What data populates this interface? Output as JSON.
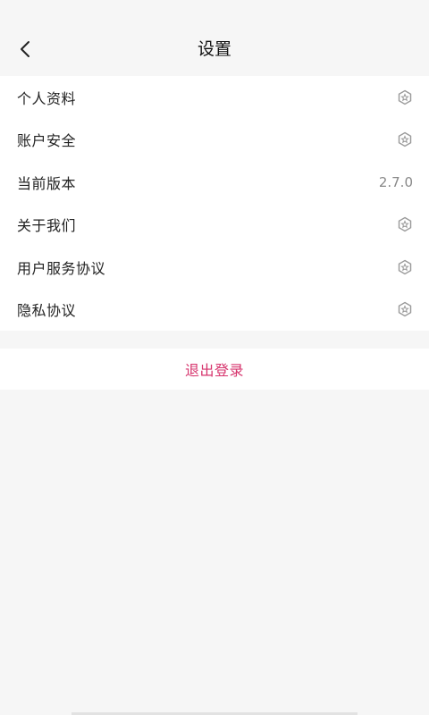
{
  "header": {
    "title": "设置",
    "back_icon": "chevron-left-icon"
  },
  "settings": {
    "items": [
      {
        "label": "个人资料",
        "icon": "hexagon-star-icon"
      },
      {
        "label": "账户安全",
        "icon": "hexagon-star-icon"
      },
      {
        "label": "当前版本",
        "value": "2.7.0"
      },
      {
        "label": "关于我们",
        "icon": "hexagon-star-icon"
      },
      {
        "label": "用户服务协议",
        "icon": "hexagon-star-icon"
      },
      {
        "label": "隐私协议",
        "icon": "hexagon-star-icon"
      }
    ]
  },
  "logout": {
    "label": "退出登录",
    "color": "#d6336c"
  },
  "colors": {
    "background": "#f6f6f6",
    "card": "#ffffff",
    "muted_text": "#888888"
  }
}
